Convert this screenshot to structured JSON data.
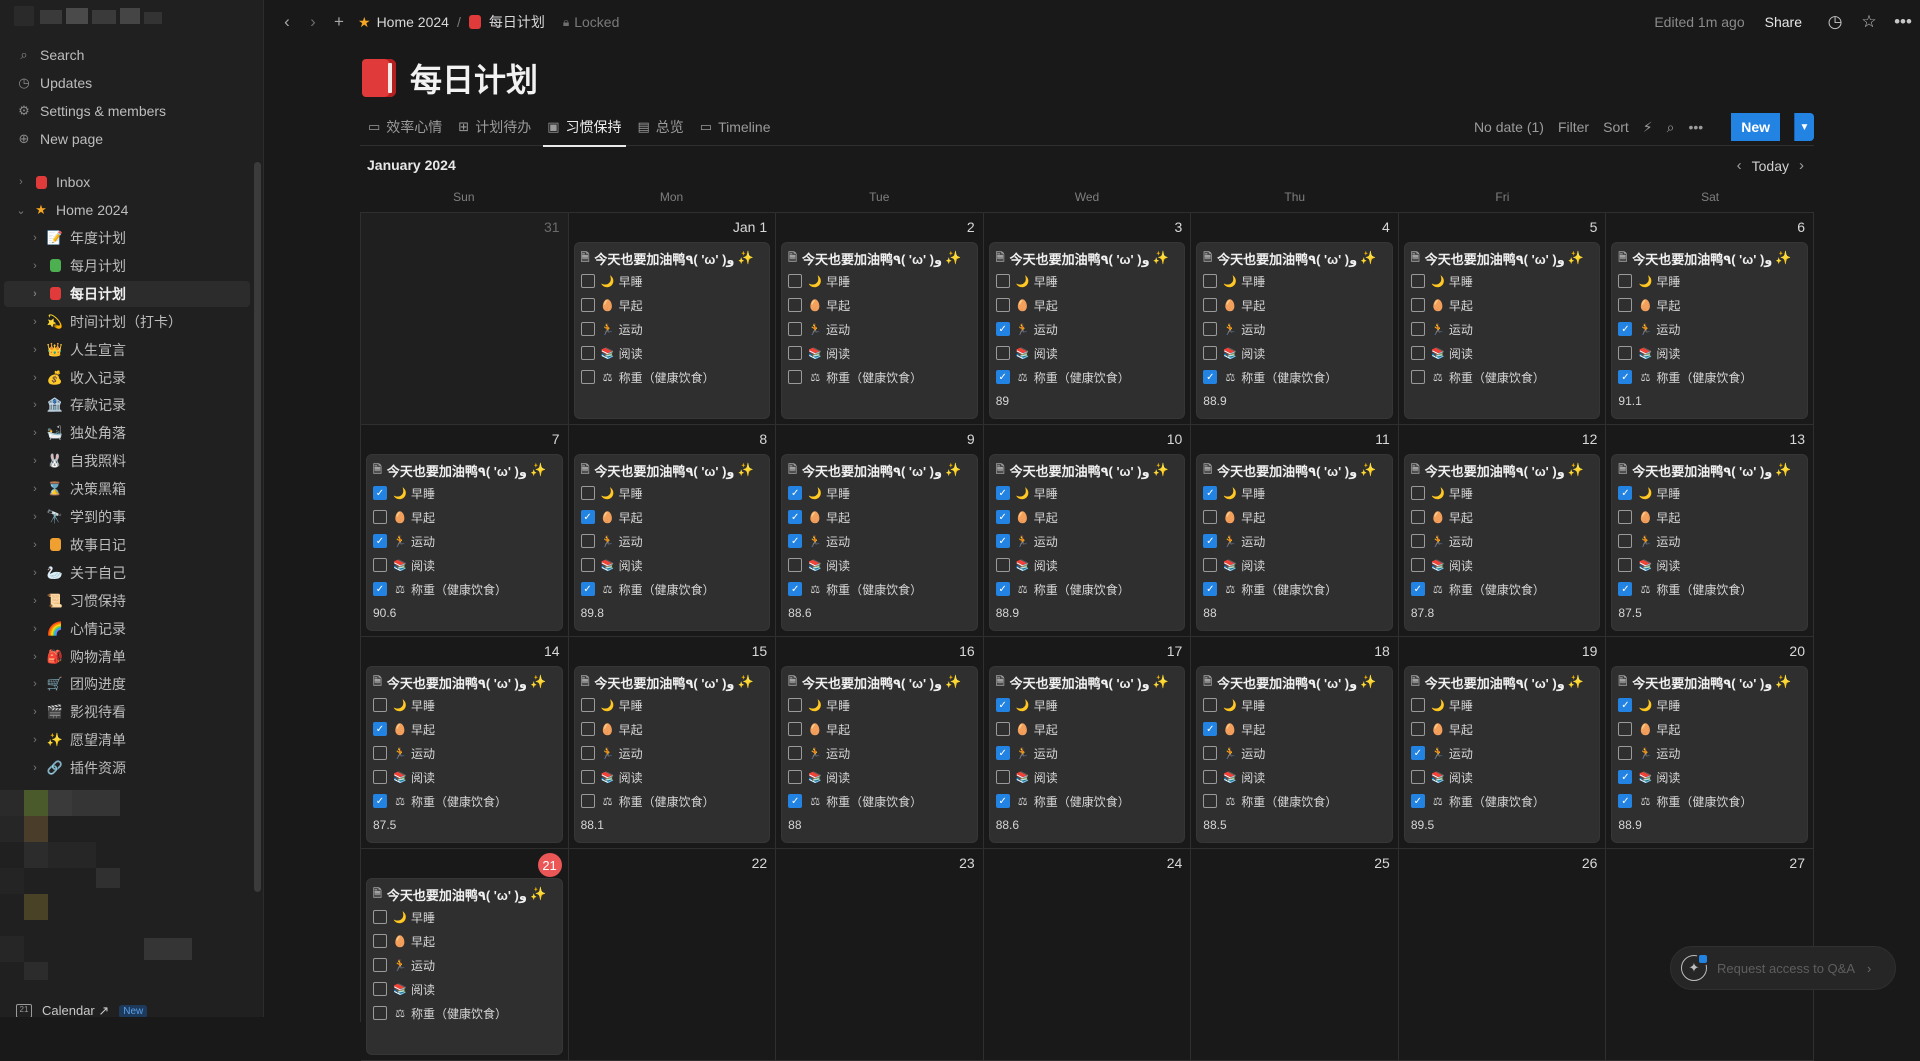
{
  "sidebar": {
    "nav": [
      {
        "label": "Search",
        "icon": "search-icon"
      },
      {
        "label": "Updates",
        "icon": "clock-icon"
      },
      {
        "label": "Settings & members",
        "icon": "gear-icon"
      },
      {
        "label": "New page",
        "icon": "plus-circle-icon"
      }
    ],
    "inbox": "Inbox",
    "home": "Home 2024",
    "pages": [
      {
        "label": "年度计划",
        "emoji": "📝"
      },
      {
        "label": "每月计划",
        "emoji": "📗"
      },
      {
        "label": "每日计划",
        "emoji": "📕",
        "active": true
      },
      {
        "label": "时间计划（打卡）",
        "emoji": "💫"
      },
      {
        "label": "人生宣言",
        "emoji": "👑"
      },
      {
        "label": "收入记录",
        "emoji": "💰"
      },
      {
        "label": "存款记录",
        "emoji": "🏦"
      },
      {
        "label": "独处角落",
        "emoji": "🛀"
      },
      {
        "label": "自我照料",
        "emoji": "🐰"
      },
      {
        "label": "决策黑箱",
        "emoji": "⌛"
      },
      {
        "label": "学到的事",
        "emoji": "🔭"
      },
      {
        "label": "故事日记",
        "emoji": "📙"
      },
      {
        "label": "关于自己",
        "emoji": "🦢"
      },
      {
        "label": "习惯保持",
        "emoji": "📜"
      },
      {
        "label": "心情记录",
        "emoji": "🌈"
      },
      {
        "label": "购物清单",
        "emoji": "🎒"
      },
      {
        "label": "团购进度",
        "emoji": "🛒"
      },
      {
        "label": "影视待看",
        "emoji": "🎬"
      },
      {
        "label": "愿望清单",
        "emoji": "✨"
      },
      {
        "label": "插件资源",
        "emoji": "🔗"
      }
    ],
    "calendar_label": "Calendar ↗",
    "calendar_badge": "New"
  },
  "topbar": {
    "crumb1": "Home 2024",
    "crumb2": "每日计划",
    "locked": "Locked",
    "edited": "Edited 1m ago",
    "share": "Share"
  },
  "page": {
    "title": "每日计划"
  },
  "views": {
    "tabs": [
      {
        "label": "效率心情",
        "icon": "▭"
      },
      {
        "label": "计划待办",
        "icon": "⊞"
      },
      {
        "label": "习惯保持",
        "icon": "▣",
        "active": true
      },
      {
        "label": "总览",
        "icon": "▤"
      },
      {
        "label": "Timeline",
        "icon": "▭"
      }
    ],
    "no_date": "No date (1)",
    "filter": "Filter",
    "sort": "Sort",
    "new": "New"
  },
  "calendar": {
    "month": "January 2024",
    "today": "Today",
    "weekdays": [
      "Sun",
      "Mon",
      "Tue",
      "Wed",
      "Thu",
      "Fri",
      "Sat"
    ],
    "habits": [
      {
        "label": "早睡",
        "emoji": "🌙"
      },
      {
        "label": "早起",
        "emoji": "🥚"
      },
      {
        "label": "运动",
        "emoji": "🏃"
      },
      {
        "label": "阅读",
        "emoji": "📚"
      },
      {
        "label": "称重（健康饮食）",
        "emoji": "⚖"
      }
    ],
    "card_title": "今天也要加油鸭٩( 'ω' )و",
    "days": [
      {
        "label": "31",
        "other": true
      },
      {
        "label": "Jan 1",
        "checks": [
          0,
          0,
          0,
          0,
          0
        ],
        "weight": ""
      },
      {
        "label": "2",
        "checks": [
          0,
          0,
          0,
          0,
          0
        ],
        "weight": ""
      },
      {
        "label": "3",
        "checks": [
          0,
          0,
          1,
          0,
          1
        ],
        "weight": "89"
      },
      {
        "label": "4",
        "checks": [
          0,
          0,
          0,
          0,
          1
        ],
        "weight": "88.9"
      },
      {
        "label": "5",
        "checks": [
          0,
          0,
          0,
          0,
          0
        ],
        "weight": ""
      },
      {
        "label": "6",
        "checks": [
          0,
          0,
          1,
          0,
          1
        ],
        "weight": "91.1"
      },
      {
        "label": "7",
        "checks": [
          1,
          0,
          1,
          0,
          1
        ],
        "weight": "90.6"
      },
      {
        "label": "8",
        "checks": [
          0,
          1,
          0,
          0,
          1
        ],
        "weight": "89.8"
      },
      {
        "label": "9",
        "checks": [
          1,
          1,
          1,
          0,
          1
        ],
        "weight": "88.6"
      },
      {
        "label": "10",
        "checks": [
          1,
          1,
          1,
          0,
          1
        ],
        "weight": "88.9"
      },
      {
        "label": "11",
        "checks": [
          1,
          0,
          1,
          0,
          1
        ],
        "weight": "88"
      },
      {
        "label": "12",
        "checks": [
          0,
          0,
          0,
          0,
          1
        ],
        "weight": "87.8"
      },
      {
        "label": "13",
        "checks": [
          1,
          0,
          0,
          0,
          1
        ],
        "weight": "87.5"
      },
      {
        "label": "14",
        "checks": [
          0,
          1,
          0,
          0,
          1
        ],
        "weight": "87.5"
      },
      {
        "label": "15",
        "checks": [
          0,
          0,
          0,
          0,
          0
        ],
        "weight": "88.1"
      },
      {
        "label": "16",
        "checks": [
          0,
          0,
          0,
          0,
          1
        ],
        "weight": "88"
      },
      {
        "label": "17",
        "checks": [
          1,
          0,
          1,
          0,
          1
        ],
        "weight": "88.6"
      },
      {
        "label": "18",
        "checks": [
          0,
          1,
          0,
          0,
          0
        ],
        "weight": "88.5"
      },
      {
        "label": "19",
        "checks": [
          0,
          0,
          1,
          0,
          1
        ],
        "weight": "89.5"
      },
      {
        "label": "20",
        "checks": [
          1,
          0,
          0,
          1,
          1
        ],
        "weight": "88.9"
      },
      {
        "label": "21",
        "today": true,
        "checks": [
          0,
          0,
          0,
          0,
          0
        ],
        "weight": ""
      },
      {
        "label": "22"
      },
      {
        "label": "23"
      },
      {
        "label": "24"
      },
      {
        "label": "25"
      },
      {
        "label": "26"
      },
      {
        "label": "27"
      }
    ]
  },
  "qa": {
    "label": "Request access to Q&A"
  }
}
